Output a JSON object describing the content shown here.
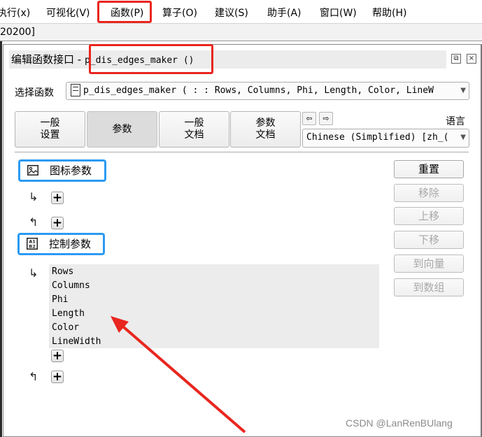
{
  "menubar": {
    "items": [
      {
        "label": "执行(x)"
      },
      {
        "label": "可视化(V)"
      },
      {
        "label": "函数(P)"
      },
      {
        "label": "算子(O)"
      },
      {
        "label": "建议(S)"
      },
      {
        "label": "助手(A)"
      },
      {
        "label": "窗口(W)"
      },
      {
        "label": "帮助(H)"
      }
    ]
  },
  "pathbar": {
    "text": "20200]"
  },
  "dialog": {
    "title_prefix": "编辑函数接口 - ",
    "title_func": "p_dis_edges_maker ()",
    "restore_icon": "restore-icon",
    "close_icon": "close-icon",
    "select_label": "选择函数",
    "select_value": "p_dis_edges_maker ( : : Rows, Columns, Phi, Length, Color, LineW",
    "tabs": [
      {
        "label": "一般\n设置",
        "active": false
      },
      {
        "label": "参数",
        "active": true
      },
      {
        "label": "一般\n文档",
        "active": false
      },
      {
        "label": "参数\n文档",
        "active": false
      }
    ],
    "nav_prev": "⇦",
    "nav_next": "⇨",
    "language_label": "语言",
    "language_value": "Chinese (Simplified) [zh_(",
    "sections": [
      {
        "label": "图标参数",
        "icon": "image-icon",
        "params": []
      },
      {
        "label": "控制参数",
        "icon": "a1b2-icon",
        "params": [
          "Rows",
          "Columns",
          "Phi",
          "Length",
          "Color",
          "LineWidth"
        ]
      }
    ],
    "input_arrow": "↳",
    "output_arrow": "↰",
    "plus": "+",
    "side_buttons": [
      {
        "label": "重置",
        "enabled": true
      },
      {
        "label": "移除",
        "enabled": false
      },
      {
        "label": "上移",
        "enabled": false
      },
      {
        "label": "下移",
        "enabled": false
      },
      {
        "label": "到向量",
        "enabled": false
      },
      {
        "label": "到数组",
        "enabled": false
      }
    ]
  },
  "annotations": {
    "highlight_color": "#e8261f",
    "section_color": "#2b9af3"
  },
  "watermark": "CSDN @LanRenBUlang"
}
